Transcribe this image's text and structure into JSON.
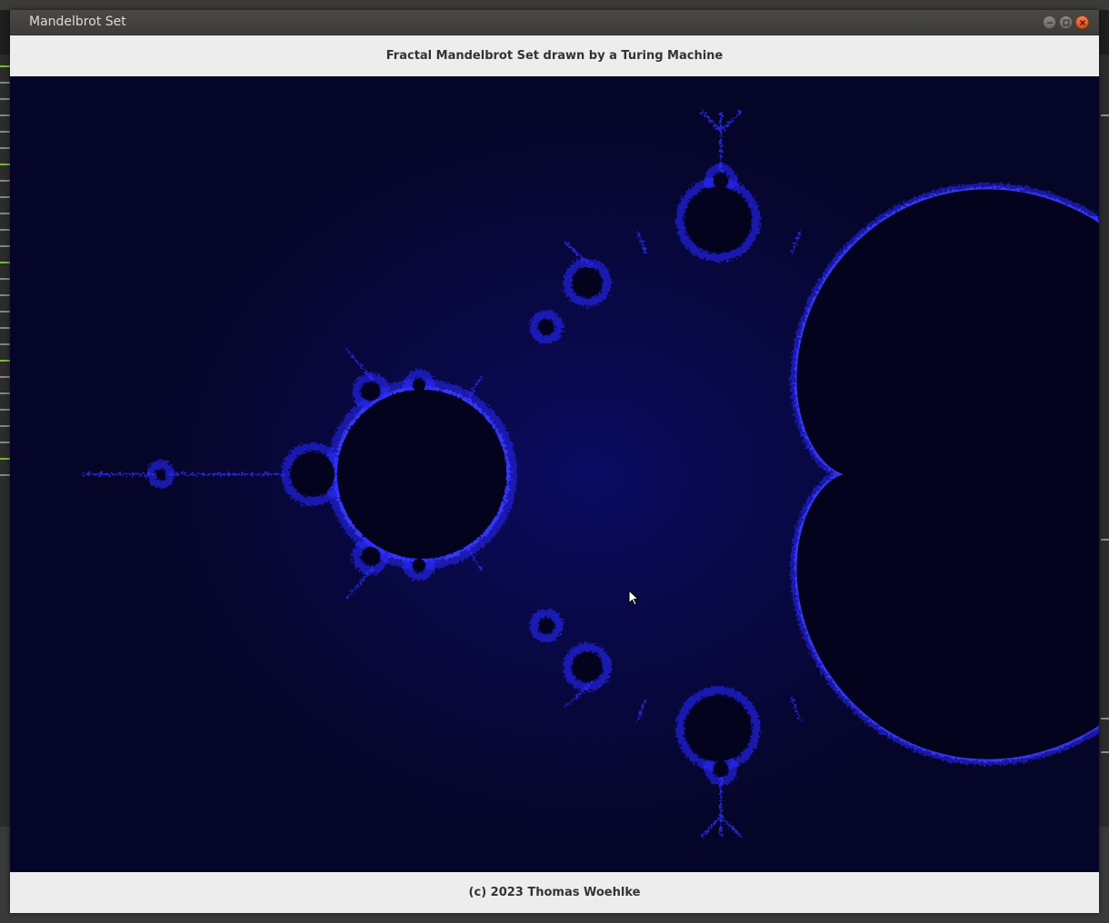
{
  "window": {
    "title": "Mandelbrot Set",
    "controls": {
      "minimize_icon": "minimize-icon",
      "maximize_icon": "maximize-icon",
      "close_icon": "close-icon"
    }
  },
  "header": {
    "title": "Fractal Mandelbrot Set drawn by a Turing Machine"
  },
  "fractal": {
    "background_color": "#050528",
    "set_color": "#03031e",
    "edge_color": "#2a2aff",
    "glow_color": "#0a0a60"
  },
  "footer": {
    "text": "(c) 2023 Thomas Woehlke"
  },
  "colors": {
    "window_chrome": "#3c3b37",
    "close_button": "#e95420",
    "panel_background": "#ededed"
  }
}
